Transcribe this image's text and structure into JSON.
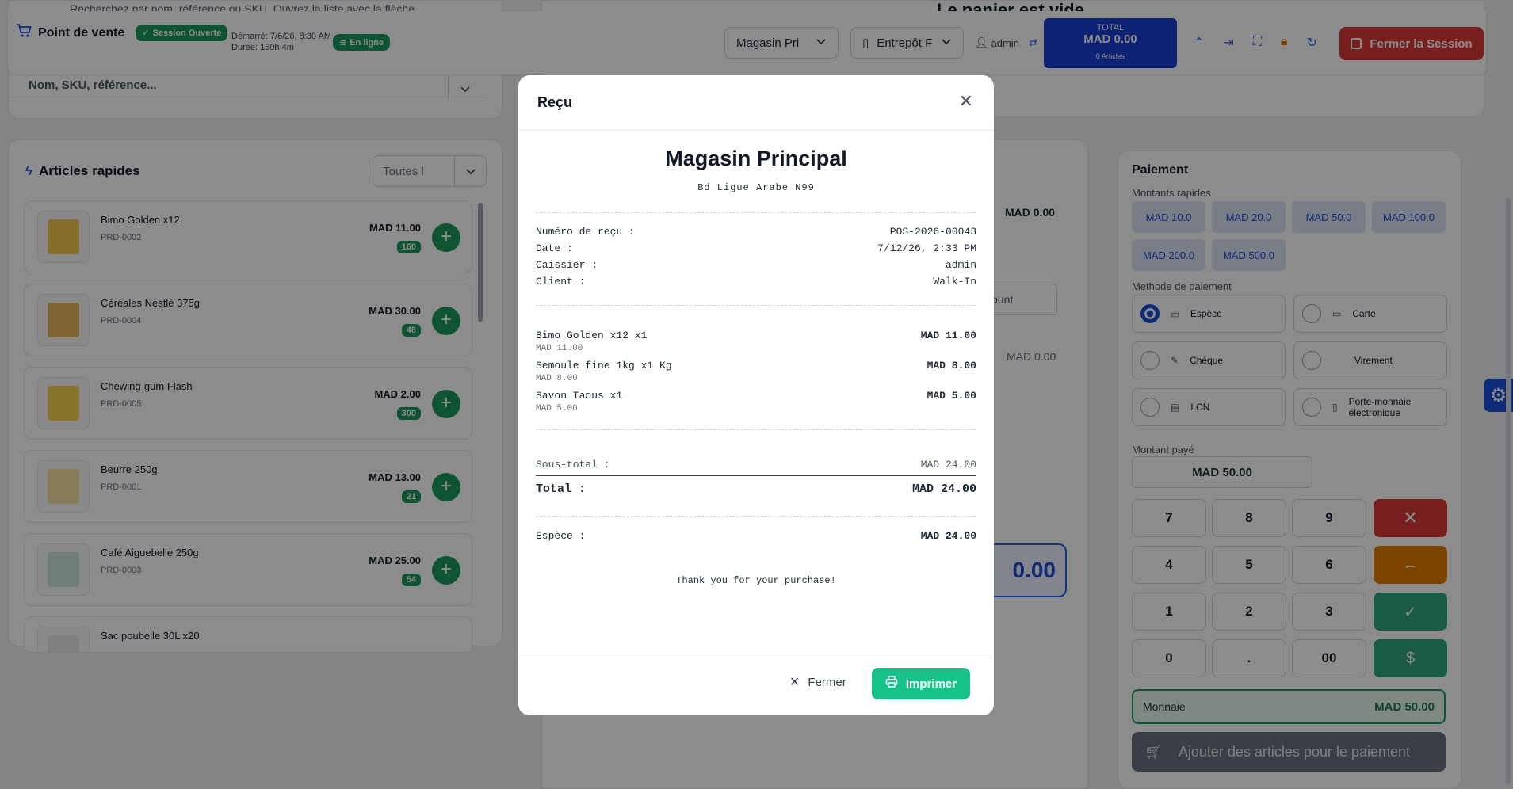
{
  "search": {
    "hint": "Recherchez par nom, référence ou SKU. Ouvrez la liste avec la flèche",
    "placeholder": "Nom, SKU, référence..."
  },
  "header": {
    "title": "Point de vente",
    "session_badge": "Session Ouverte",
    "started": "Démarré: 7/6/26, 8:30 AM",
    "duration": "Durée: 150h 4m",
    "online_badge": "En ligne",
    "store_select": "Magasin Pri",
    "warehouse_select": "Entrepôt F",
    "user": "admin",
    "total_label": "TOTAL",
    "total_value": "MAD 0.00",
    "total_articles": "0 Articles",
    "close_session": "Fermer la Session"
  },
  "quick": {
    "title": "Articles rapides",
    "category": "Toutes l",
    "items": [
      {
        "name": "Bimo Golden x12",
        "sku": "PRD-0002",
        "price": "MAD 11.00",
        "stock": "160"
      },
      {
        "name": "Céréales Nestlé 375g",
        "sku": "PRD-0004",
        "price": "MAD 30.00",
        "stock": "48"
      },
      {
        "name": "Chewing-gum Flash",
        "sku": "PRD-0005",
        "price": "MAD 2.00",
        "stock": "300"
      },
      {
        "name": "Beurre 250g",
        "sku": "PRD-0001",
        "price": "MAD 13.00",
        "stock": "21"
      },
      {
        "name": "Café Aiguebelle 250g",
        "sku": "PRD-0003",
        "price": "MAD 25.00",
        "stock": "54"
      },
      {
        "name": "Sac poubelle 30L x20",
        "sku": "",
        "price": "",
        "stock": ""
      }
    ]
  },
  "cart": {
    "empty_title": "Le panier est vide",
    "amount1": "MAD 0.00",
    "discount_select": "ount",
    "amount2": "MAD 0.00",
    "big_total": "0.00"
  },
  "payment": {
    "title": "Paiement",
    "quick_label": "Montants rapides",
    "quick_amounts": [
      "MAD 10.0",
      "MAD 20.0",
      "MAD 50.0",
      "MAD 100.0",
      "MAD 200.0",
      "MAD 500.0"
    ],
    "method_label": "Methode de paiement",
    "methods": [
      "Espèce",
      "Carte",
      "Chèque",
      "Virement",
      "LCN",
      "Porte-monnaie électronique"
    ],
    "paid_label": "Montant payé",
    "paid_value": "MAD 50.00",
    "keys": [
      "7",
      "8",
      "9",
      "4",
      "5",
      "6",
      "1",
      "2",
      "3",
      "0",
      ".",
      "00"
    ],
    "change_label": "Monnaie",
    "change_value": "MAD 50.00",
    "add_button": "Ajouter des articles pour le paiement"
  },
  "modal": {
    "title": "Reçu",
    "store_name": "Magasin Principal",
    "address": "Bd Ligue Arabe N99",
    "info": [
      {
        "label": "Numéro de reçu :",
        "value": "POS-2026-00043"
      },
      {
        "label": "Date :",
        "value": "7/12/26, 2:33 PM"
      },
      {
        "label": "Caissier :",
        "value": "admin"
      },
      {
        "label": "Client :",
        "value": "Walk-In"
      }
    ],
    "lines": [
      {
        "name": "Bimo Golden x12 x1",
        "total": "MAD 11.00",
        "unit": "MAD 11.00"
      },
      {
        "name": "Semoule fine 1kg x1 Kg",
        "total": "MAD 8.00",
        "unit": "MAD 8.00"
      },
      {
        "name": "Savon Taous x1",
        "total": "MAD 5.00",
        "unit": "MAD 5.00"
      }
    ],
    "subtotal_label": "Sous-total :",
    "subtotal_value": "MAD 24.00",
    "total_label": "Total :",
    "total_value": "MAD 24.00",
    "payment_label": "Espèce :",
    "payment_value": "MAD 24.00",
    "thanks": "Thank you for your purchase!",
    "close_button": "Fermer",
    "print_button": "Imprimer"
  }
}
